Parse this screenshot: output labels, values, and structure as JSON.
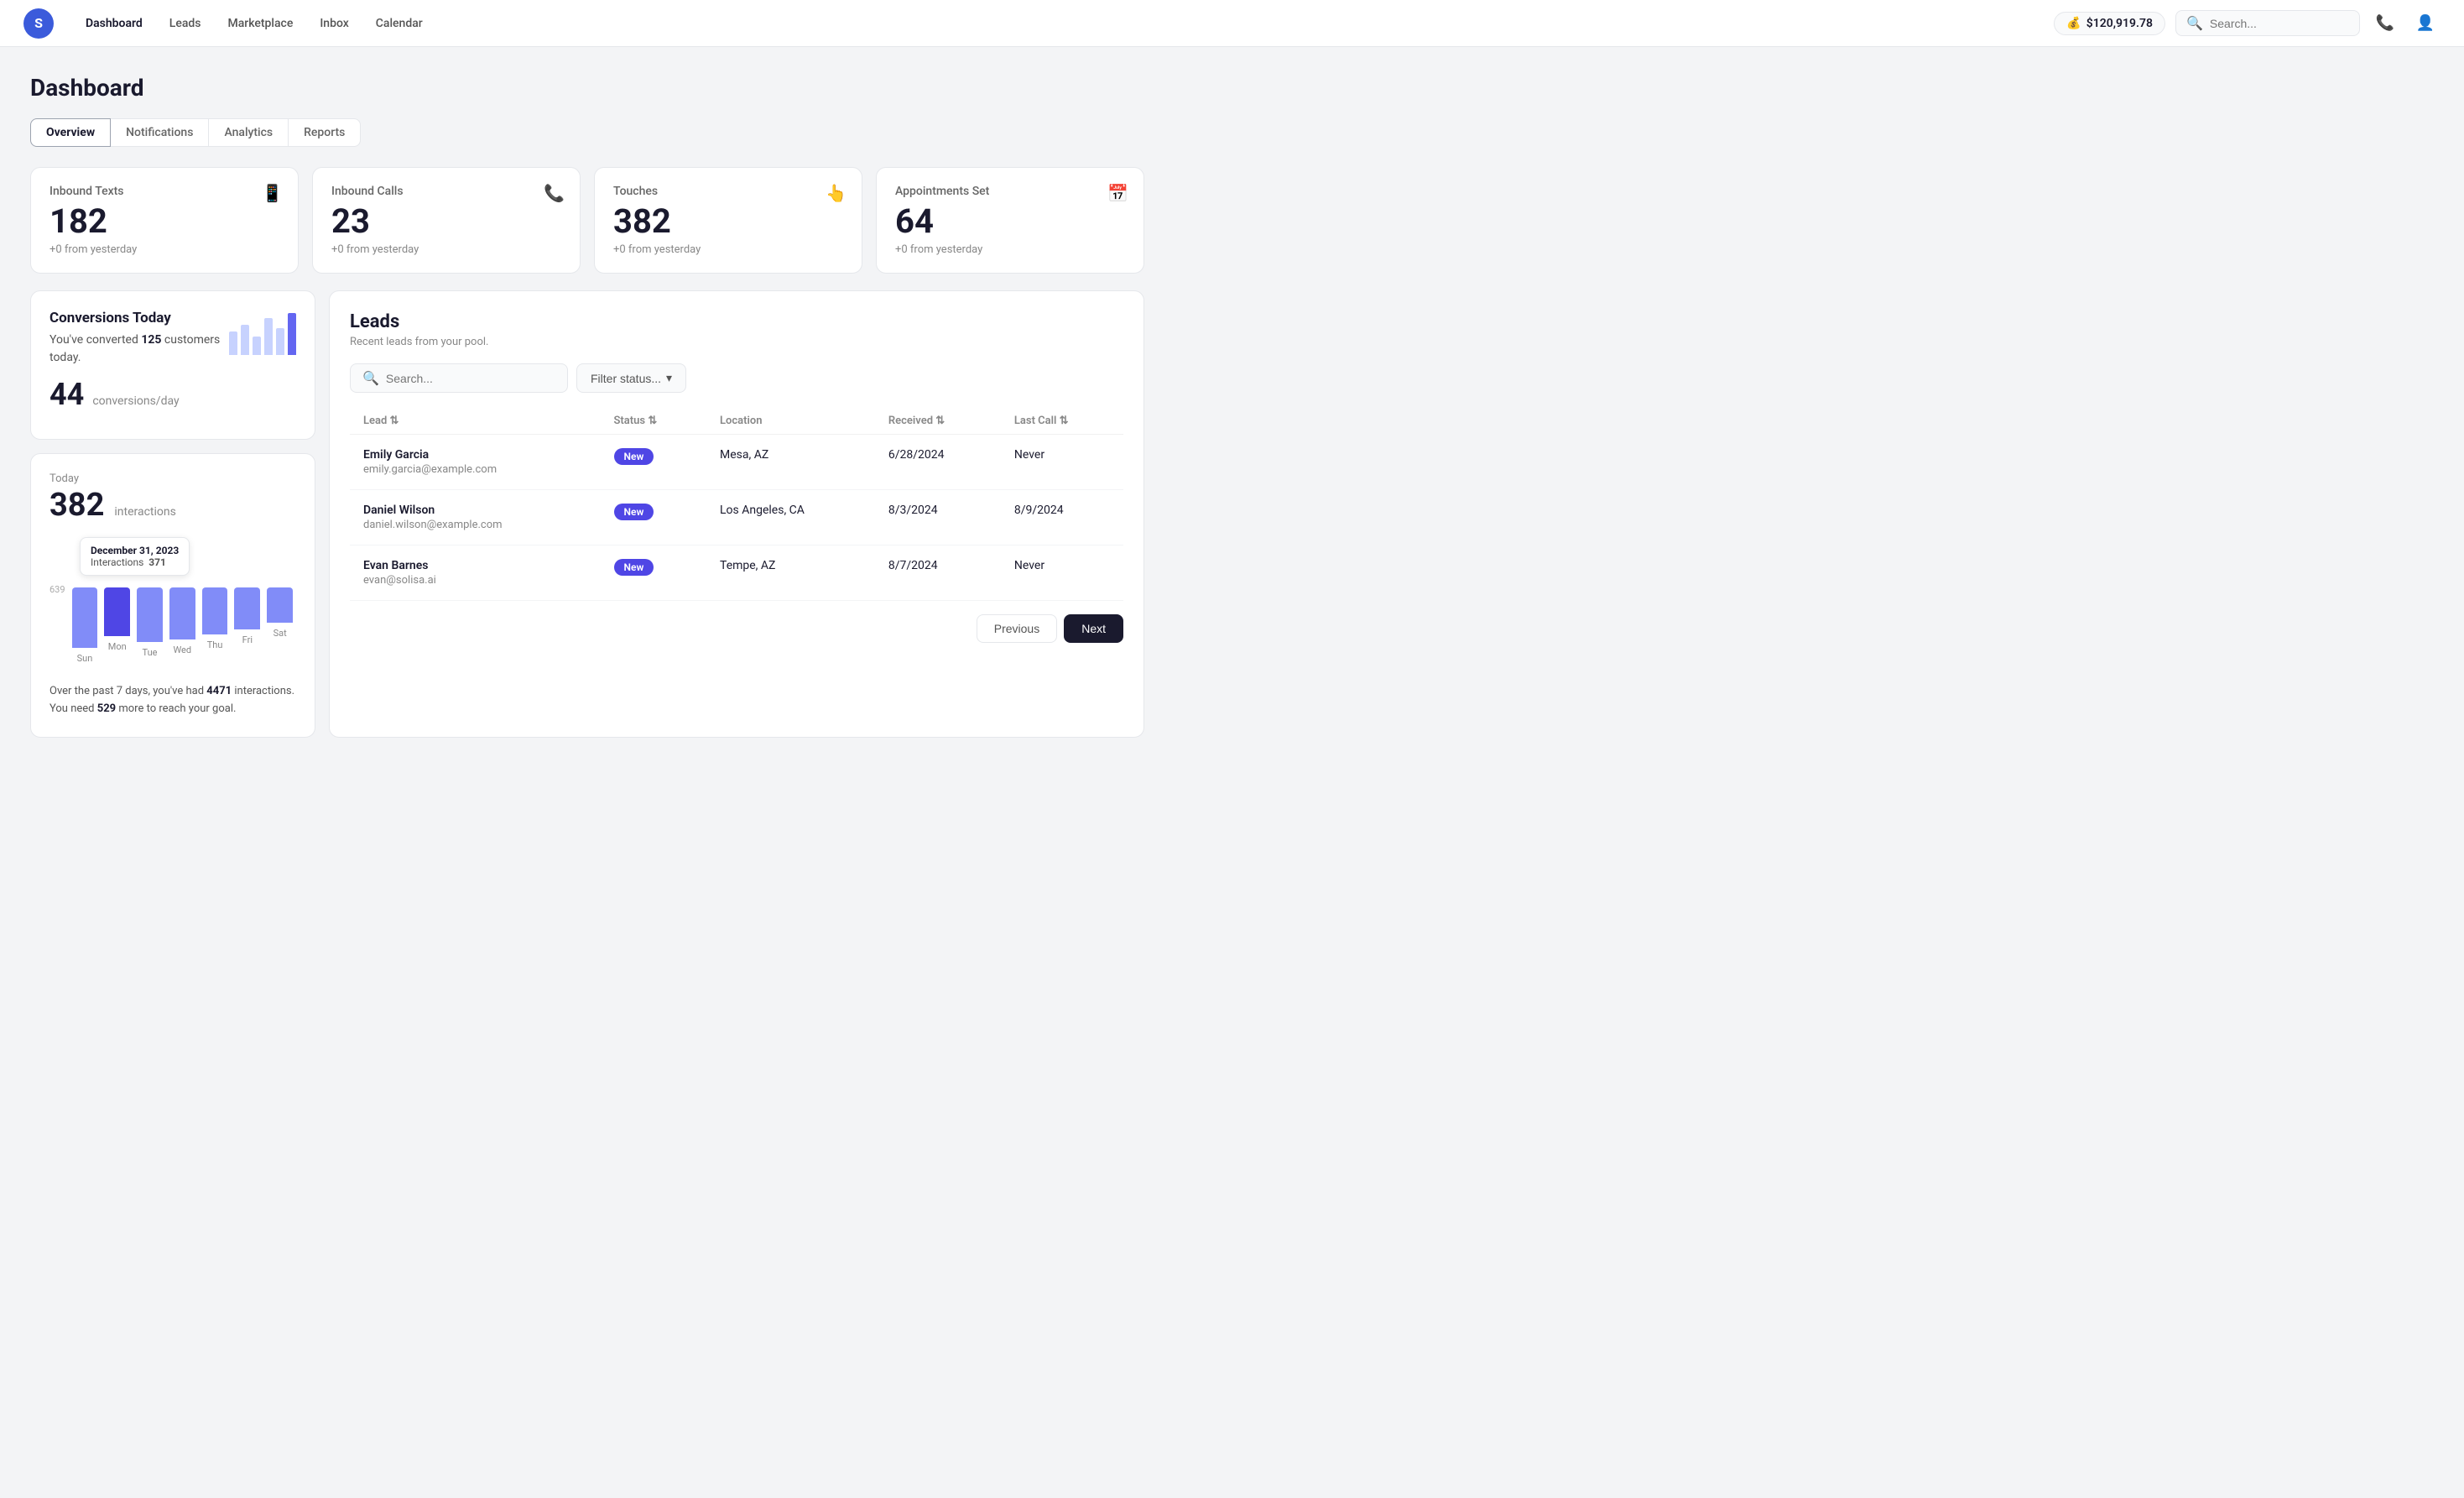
{
  "app": {
    "logo_text": "S",
    "balance": "$120,919.78",
    "search_placeholder": "Search...",
    "nav_links": [
      {
        "label": "Dashboard",
        "active": true
      },
      {
        "label": "Leads",
        "active": false
      },
      {
        "label": "Marketplace",
        "active": false
      },
      {
        "label": "Inbox",
        "active": false
      },
      {
        "label": "Calendar",
        "active": false
      }
    ]
  },
  "page": {
    "title": "Dashboard",
    "tabs": [
      {
        "label": "Overview",
        "active": true
      },
      {
        "label": "Notifications",
        "active": false
      },
      {
        "label": "Analytics",
        "active": false
      },
      {
        "label": "Reports",
        "active": false
      }
    ]
  },
  "stats": [
    {
      "label": "Inbound Texts",
      "value": "182",
      "change": "+0 from yesterday",
      "icon": "📱"
    },
    {
      "label": "Inbound Calls",
      "value": "23",
      "change": "+0 from yesterday",
      "icon": "📞"
    },
    {
      "label": "Touches",
      "value": "382",
      "change": "+0 from yesterday",
      "icon": "👆"
    },
    {
      "label": "Appointments Set",
      "value": "64",
      "change": "+0 from yesterday",
      "icon": "📅"
    }
  ],
  "conversions": {
    "title": "Conversions Today",
    "subtitle_prefix": "You've converted",
    "customers_count": "125",
    "subtitle_suffix": "customers today.",
    "big_number": "44",
    "label": "conversions/day"
  },
  "interactions": {
    "label_today": "Today",
    "big_number": "382",
    "label": "interactions",
    "tooltip_date": "December 31, 2023",
    "tooltip_label": "Interactions",
    "tooltip_value": "371",
    "y_label_top": "639",
    "days": [
      {
        "label": "Sun",
        "height": 72,
        "highlighted": false
      },
      {
        "label": "Mon",
        "height": 58,
        "highlighted": true
      },
      {
        "label": "Tue",
        "height": 65,
        "highlighted": false
      },
      {
        "label": "Wed",
        "height": 62,
        "highlighted": false
      },
      {
        "label": "Thu",
        "height": 56,
        "highlighted": false
      },
      {
        "label": "Fri",
        "height": 50,
        "highlighted": false
      },
      {
        "label": "Sat",
        "height": 42,
        "highlighted": false
      }
    ],
    "footer_line1_prefix": "Over the past 7 days, you've had",
    "footer_interactions": "4471",
    "footer_line1_suffix": "interactions.",
    "footer_line2_prefix": "You need",
    "footer_goal": "529",
    "footer_line2_suffix": "more to reach your goal."
  },
  "leads": {
    "title": "Leads",
    "subtitle": "Recent leads from your pool.",
    "search_placeholder": "Search...",
    "filter_label": "Filter status...",
    "columns": [
      "Lead",
      "Status",
      "Location",
      "Received",
      "Last Call"
    ],
    "rows": [
      {
        "name": "Emily Garcia",
        "email": "emily.garcia@example.com",
        "status": "New",
        "location": "Mesa, AZ",
        "received": "6/28/2024",
        "last_call": "Never"
      },
      {
        "name": "Daniel Wilson",
        "email": "daniel.wilson@example.com",
        "status": "New",
        "location": "Los Angeles, CA",
        "received": "8/3/2024",
        "last_call": "8/9/2024"
      },
      {
        "name": "Evan Barnes",
        "email": "evan@solisa.ai",
        "status": "New",
        "location": "Tempe, AZ",
        "received": "8/7/2024",
        "last_call": "Never"
      }
    ],
    "pagination": {
      "previous": "Previous",
      "next": "Next"
    }
  }
}
